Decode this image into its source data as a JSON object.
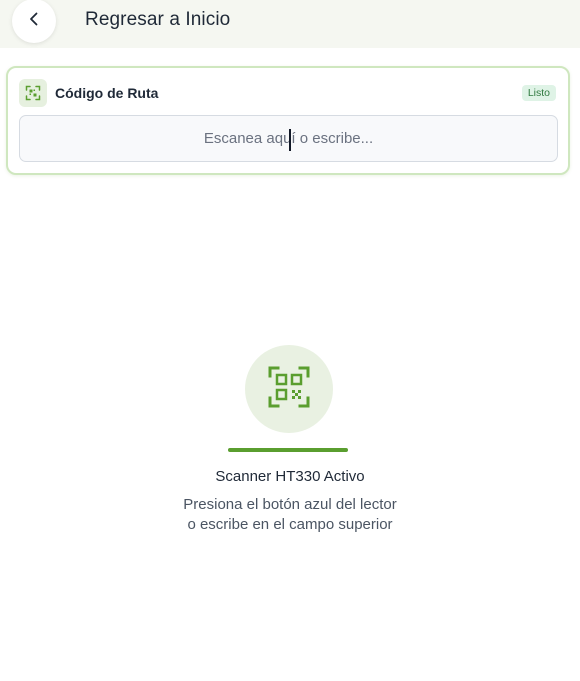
{
  "header": {
    "back_icon": "chevron-left-icon",
    "title": "Regresar a Inicio"
  },
  "route_card": {
    "icon": "qr-scan-icon",
    "label": "Código de Ruta",
    "status": "Listo",
    "input_placeholder": "Escanea aquí o escribe...",
    "input_value": ""
  },
  "scanner": {
    "icon": "qr-code-icon",
    "title": "Scanner HT330 Activo",
    "instruction_line1": "Presiona el botón azul del lector",
    "instruction_line2": "o escribe en el campo superior"
  },
  "colors": {
    "accent_green": "#5a9e2f",
    "header_bg": "#f5f7f1",
    "card_border": "#cfe7bf",
    "badge_bg": "#dff3e6",
    "badge_text": "#2f7a3f"
  }
}
